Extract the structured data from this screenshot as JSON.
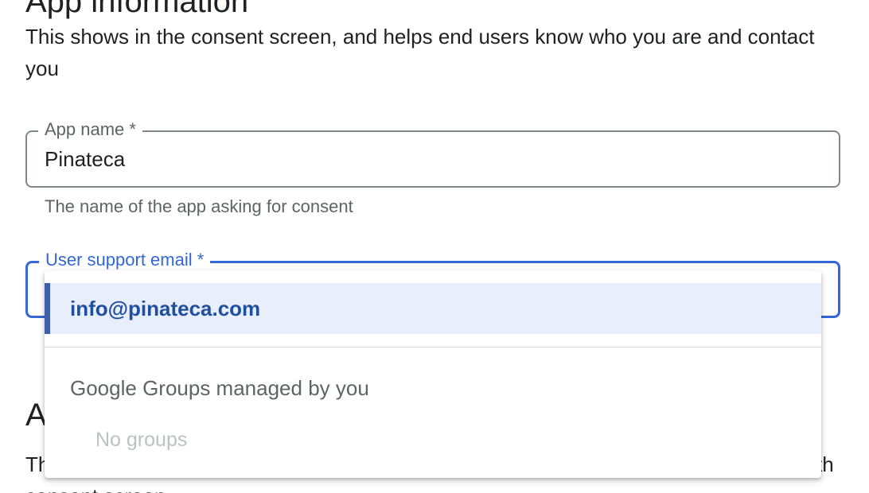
{
  "app_information": {
    "title": "App information",
    "description": "This shows in the consent screen, and helps end users know who you are and contact you"
  },
  "app_name_field": {
    "label": "App name *",
    "value": "Pinateca",
    "hint": "The name of the app asking for consent"
  },
  "support_email_field": {
    "label": "User support email *",
    "selected_value": "info@pinateca.com"
  },
  "dropdown": {
    "options": [
      {
        "label": "info@pinateca.com",
        "selected": true
      }
    ],
    "group_header": "Google Groups managed by you",
    "group_empty_text": "No groups"
  },
  "next_section": {
    "title_visible": "A",
    "description_start": "Th",
    "description_end": "th",
    "description_line2": "consent screen"
  },
  "colors": {
    "accent": "#3367d6",
    "selected_bg": "#e8eefb",
    "selected_text": "#1f4fa0",
    "muted_text": "#5f6368",
    "disabled_text": "#bdc1c6"
  }
}
